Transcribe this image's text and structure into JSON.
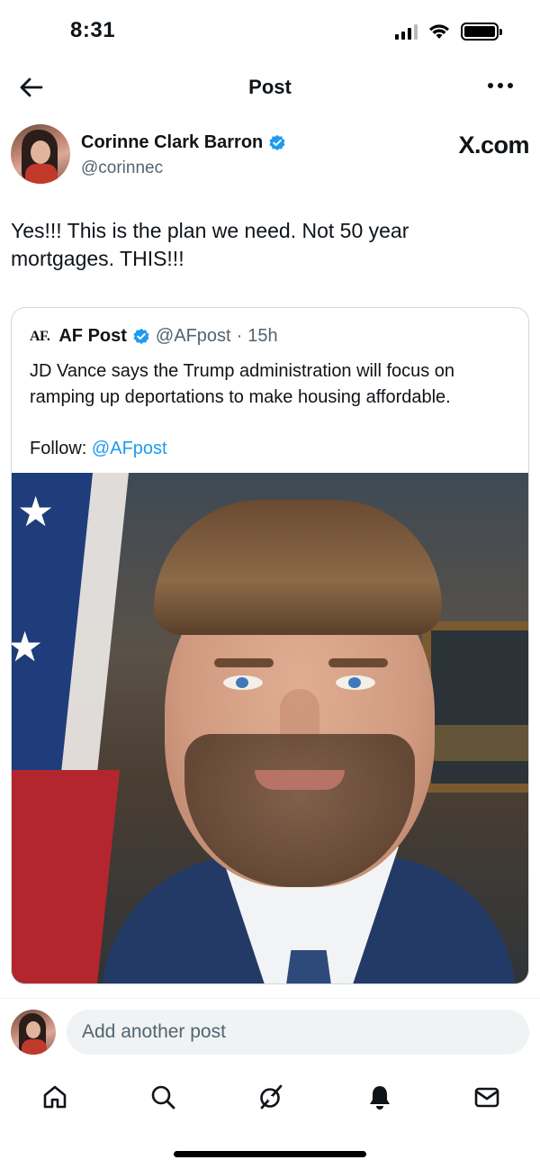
{
  "status_bar": {
    "time": "8:31"
  },
  "header": {
    "title": "Post"
  },
  "post": {
    "author_name": "Corinne Clark Barron",
    "author_handle": "@corinnec",
    "watermark": "X.com",
    "text": "Yes!!! This is the plan we need. Not 50 year mortgages. THIS!!!"
  },
  "quote": {
    "logo": "AF.",
    "name": "AF Post",
    "handle": "@AFpost",
    "separator": "·",
    "time": "15h",
    "text": "JD Vance says the Trump administration will focus on ramping up deportations to make housing affordable.",
    "follow_label": "Follow:",
    "follow_link": "@AFpost"
  },
  "reply": {
    "placeholder": "Add another post"
  },
  "nav": {
    "items": [
      "home-icon",
      "search-icon",
      "grok-icon",
      "notifications-bell-icon",
      "messages-envelope-icon"
    ]
  },
  "colors": {
    "accent": "#1d9bf0",
    "secondary_text": "#536471",
    "text": "#0f1419"
  }
}
